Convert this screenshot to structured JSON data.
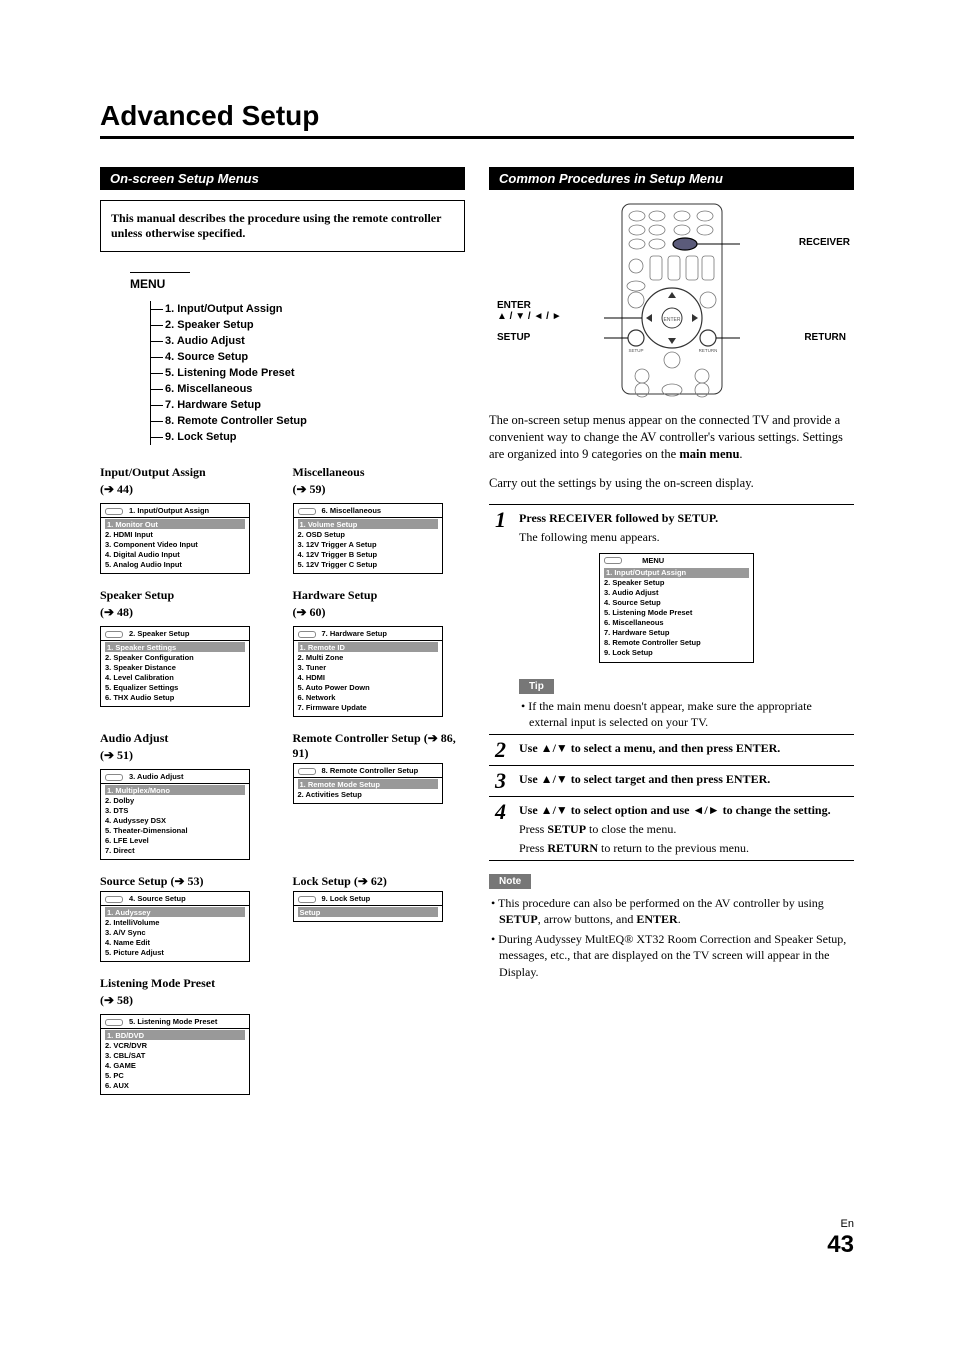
{
  "title": "Advanced Setup",
  "left": {
    "sectionHeader": "On-screen Setup Menus",
    "noteBox": "This manual describes the procedure using the remote controller unless otherwise specified.",
    "menuTree": {
      "title": "MENU",
      "items": [
        "1. Input/Output Assign",
        "2. Speaker Setup",
        "3. Audio Adjust",
        "4. Source Setup",
        "5. Listening Mode Preset",
        "6. Miscellaneous",
        "7. Hardware Setup",
        "8. Remote Controller Setup",
        "9. Lock Setup"
      ]
    },
    "subs": [
      {
        "title": "Input/Output Assign",
        "ref": "(➔ 44)",
        "menuTitle": "1.   Input/Output Assign",
        "items": [
          "1.   Monitor Out",
          "2.   HDMI Input",
          "3.   Component Video Input",
          "4.   Digital Audio Input",
          "5.   Analog Audio Input"
        ],
        "highlight": "1.   Monitor Out"
      },
      {
        "title": "Miscellaneous",
        "ref": "(➔ 59)",
        "menuTitle": "6.   Miscellaneous",
        "items": [
          "1.   Volume Setup",
          "2.   OSD Setup",
          "3.   12V Trigger A Setup",
          "4.   12V Trigger B Setup",
          "5.   12V Trigger C Setup"
        ],
        "highlight": "1.   Volume Setup"
      },
      {
        "title": "Speaker Setup",
        "ref": "(➔ 48)",
        "menuTitle": "2.   Speaker Setup",
        "items": [
          "1.   Speaker Settings",
          "2.   Speaker Configuration",
          "3.   Speaker Distance",
          "4.   Level Calibration",
          "5.   Equalizer Settings",
          "6.   THX Audio Setup"
        ],
        "highlight": "1.   Speaker Settings"
      },
      {
        "title": "Hardware Setup",
        "ref": "(➔ 60)",
        "menuTitle": "7.   Hardware Setup",
        "items": [
          "1.   Remote ID",
          "2.   Multi Zone",
          "3.   Tuner",
          "4.   HDMI",
          "5.   Auto Power Down",
          "6.   Network",
          "7.   Firmware Update"
        ],
        "highlight": "1.   Remote ID"
      },
      {
        "title": "Audio Adjust",
        "ref": "(➔ 51)",
        "menuTitle": "3.   Audio Adjust",
        "items": [
          "1.   Multiplex/Mono",
          "2.   Dolby",
          "3.   DTS",
          "4.   Audyssey DSX",
          "5.   Theater-Dimensional",
          "6.   LFE Level",
          "7.   Direct"
        ],
        "highlight": "1.   Multiplex/Mono"
      },
      {
        "title": "Remote Controller Setup (➔ 86, 91)",
        "refInline": true,
        "menuTitle": "8.   Remote Controller Setup",
        "items": [
          "1.   Remote Mode Setup",
          "2.   Activities Setup"
        ],
        "highlight": "1.   Remote Mode Setup"
      },
      {
        "title": "Source Setup (➔ 53)",
        "refInline": true,
        "menuTitle": "4.   Source Setup",
        "items": [
          "1.   Audyssey",
          "2.   IntelliVolume",
          "3.   A/V Sync",
          "4.   Name Edit",
          "5.   Picture Adjust"
        ],
        "highlight": "1.   Audyssey"
      },
      {
        "title": "Lock Setup (➔ 62)",
        "refInline": true,
        "menuTitle": "9.   Lock Setup",
        "items": [
          "Setup"
        ],
        "highlight": "Setup"
      },
      {
        "title": "Listening Mode Preset",
        "ref": "(➔ 58)",
        "menuTitle": "5.   Listening Mode Preset",
        "items": [
          "1.   BD/DVD",
          "2.   VCR/DVR",
          "3.   CBL/SAT",
          "4.   GAME",
          "5.   PC",
          "6.   AUX"
        ],
        "highlight": "1.   BD/DVD",
        "fullwidth": true
      }
    ]
  },
  "right": {
    "sectionHeader": "Common Procedures in Setup Menu",
    "remoteLabels": {
      "receiver": "RECEIVER",
      "enter": "ENTER",
      "arrows": "▲ / ▼ / ◄ / ►",
      "setup": "SETUP",
      "return": "RETURN"
    },
    "intro1": "The on-screen setup menus appear on the connected TV and provide a convenient way to change the AV controller's various settings. Settings are organized into 9 categories on the ",
    "intro1b": "main menu",
    "intro1c": ".",
    "intro2": "Carry out the settings by using the on-screen display.",
    "steps": [
      {
        "num": "1",
        "l1a": "Press ",
        "l1b": "RECEIVER",
        "l1c": " followed by ",
        "l1d": "SETUP",
        "l1e": ".",
        "sub": "The following menu appears."
      },
      {
        "num": "2",
        "text_a": "Use ",
        "text_b": "▲",
        "text_c": "/",
        "text_d": "▼",
        "text_e": " to select a menu, and then press ",
        "text_f": "ENTER",
        "text_g": "."
      },
      {
        "num": "3",
        "text_a": "Use ",
        "text_b": "▲",
        "text_c": "/",
        "text_d": "▼",
        "text_e": " to select target and then press ",
        "text_f": "ENTER",
        "text_g": "."
      },
      {
        "num": "4",
        "t4a": "Use ",
        "t4b": "▲",
        "t4c": "/",
        "t4d": "▼",
        "t4e": " to select option and use ",
        "t4f": "◄",
        "t4g": "/",
        "t4h": "►",
        "t4i": " to change the setting.",
        "sub1a": "Press ",
        "sub1b": "SETUP",
        "sub1c": " to close the menu.",
        "sub2a": "Press ",
        "sub2b": "RETURN",
        "sub2c": " to return to the previous menu."
      }
    ],
    "step1menu": {
      "title": "MENU",
      "items": [
        "1. Input/Output Assign",
        "2. Speaker Setup",
        "3. Audio Adjust",
        "4. Source Setup",
        "5. Listening Mode Preset",
        "6. Miscellaneous",
        "7. Hardware Setup",
        "8. Remote Controller Setup",
        "9. Lock Setup"
      ],
      "highlight": "1. Input/Output Assign"
    },
    "tipLabel": "Tip",
    "tip1": "• If the main menu doesn't appear, make sure the appropriate external input is selected on your TV.",
    "noteLabel": "Note",
    "note1_a": "• This procedure can also be performed on the AV controller by using ",
    "note1_b": "SETUP",
    "note1_c": ", arrow buttons, and ",
    "note1_d": "ENTER",
    "note1_e": ".",
    "note2": "• During Audyssey MultEQ® XT32 Room Correction and Speaker Setup, messages, etc., that are displayed on the TV screen will appear in the Display."
  },
  "footer": {
    "en": "En",
    "page": "43"
  }
}
